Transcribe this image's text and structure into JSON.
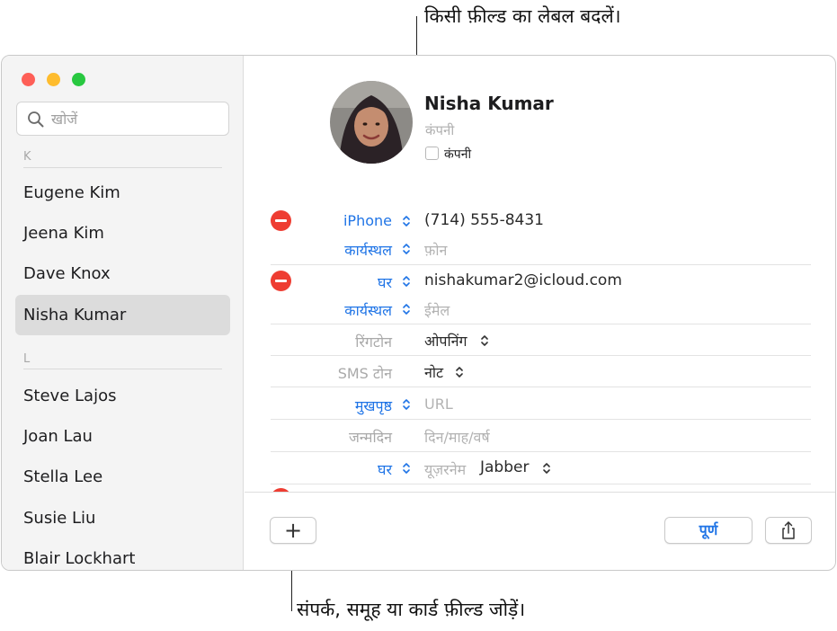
{
  "callouts": {
    "top": "किसी फ़ील्ड का लेबल बदलें।",
    "bottom": "संपर्क, समूह या कार्ड फ़ील्ड जोड़ें।"
  },
  "search": {
    "placeholder": "खोजें"
  },
  "sidebar": {
    "sections": [
      {
        "letter": "K",
        "contacts": [
          "Eugene Kim",
          "Jeena Kim",
          "Dave Knox",
          "Nisha Kumar"
        ]
      },
      {
        "letter": "L",
        "contacts": [
          "Steve Lajos",
          "Joan Lau",
          "Stella Lee",
          "Susie Liu",
          "Blair Lockhart"
        ]
      }
    ],
    "selected": "Nisha Kumar"
  },
  "card": {
    "name": "Nisha  Kumar",
    "company_placeholder": "कंपनी",
    "company_checkbox_label": "कंपनी",
    "fields": {
      "phone1": {
        "label": "iPhone",
        "value": "(714) 555-8431"
      },
      "phone2": {
        "label": "कार्यस्थल",
        "placeholder": "फ़ोन"
      },
      "email1": {
        "label": "घर",
        "value": "nishakumar2@icloud.com"
      },
      "email2": {
        "label": "कार्यस्थल",
        "placeholder": "ईमेल"
      },
      "ringtone": {
        "label": "रिंगटोन",
        "value": "ओपनिंग"
      },
      "sms": {
        "label": "SMS टोन",
        "value": "नोट"
      },
      "homepage": {
        "label": "मुखपृष्ठ",
        "placeholder": "URL"
      },
      "birthday": {
        "label": "जन्मदिन",
        "placeholder": "दिन/माह/वर्ष"
      },
      "im": {
        "label": "घर",
        "placeholder": "यूज़रनेम",
        "service": "Jabber"
      }
    }
  },
  "buttons": {
    "add": "+",
    "done": "पूर्ण"
  },
  "colors": {
    "accent": "#1f74e6",
    "delete": "#ee3d32",
    "selected_row": "#dcdcdc"
  }
}
